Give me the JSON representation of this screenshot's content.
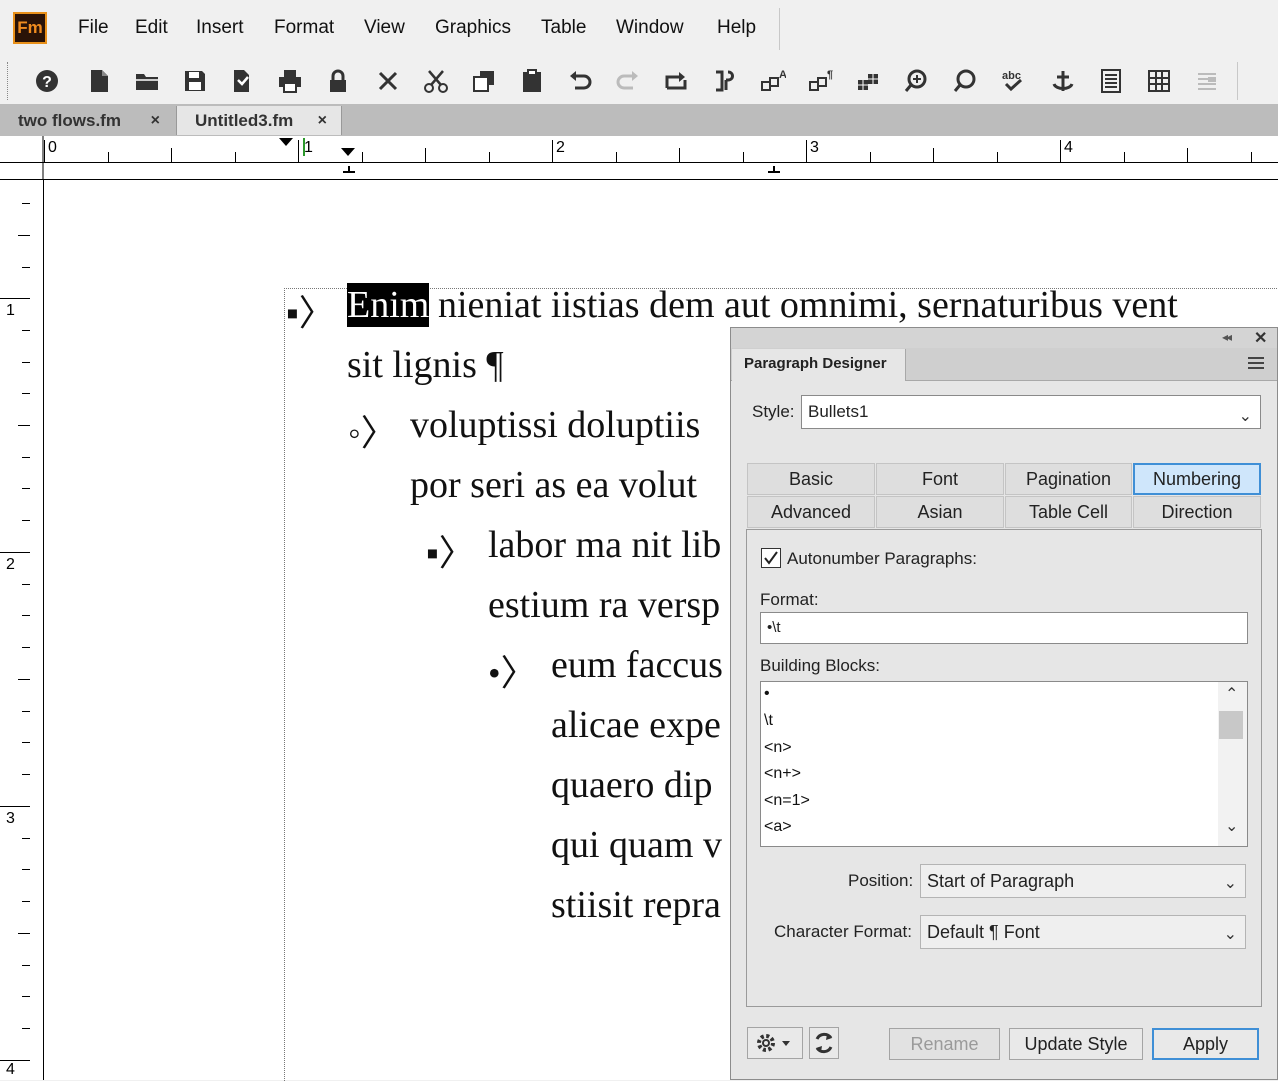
{
  "app": {
    "logo": "Fm"
  },
  "menu": [
    "File",
    "Edit",
    "Insert",
    "Format",
    "View",
    "Graphics",
    "Table",
    "Window",
    "Help"
  ],
  "toolbar": {
    "icons": [
      "help-icon",
      "new-document-icon",
      "open-folder-icon",
      "save-icon",
      "save-all-icon",
      "print-icon",
      "lock-icon",
      "close-icon",
      "cut-icon",
      "copy-icon",
      "paste-icon",
      "undo-icon",
      "redo-icon",
      "repeat-icon",
      "paragraph-flow-icon",
      "text-style-a-icon",
      "text-style-paragraph-icon",
      "table-insert-icon",
      "find-replace-icon",
      "search-icon",
      "spell-check-icon",
      "anchor-icon",
      "text-frame-icon",
      "table-icon",
      "list-style-icon"
    ]
  },
  "tabs": [
    {
      "label": "two flows.fm",
      "close": "×"
    },
    {
      "label": "Untitled3.fm",
      "close": "×"
    }
  ],
  "ruler": {
    "horizontal": [
      "0",
      "1",
      "2",
      "3",
      "4"
    ],
    "vertical": [
      "1",
      "2",
      "3",
      "4"
    ]
  },
  "document": {
    "line1_highlight": "Enim",
    "line1_rest": " nieniat iistias dem aut omnimi, sernaturibus vent",
    "line2": "sit lignis ¶",
    "line3": "voluptissi doluptiis",
    "line4": "por seri as ea volut",
    "line5": "labor ma nit lib",
    "line6": "estium ra versp",
    "line7": "eum faccus",
    "line8": "alicae expe",
    "line9": "quaero dip",
    "line10": "qui quam v",
    "line11": "stiisit repra",
    "bullet1": "▪〉",
    "bullet2": "◦〉",
    "bullet3": "▪〉",
    "bullet4": "•〉"
  },
  "panel": {
    "title": "Paragraph Designer",
    "style_label": "Style:",
    "style_value": "Bullets1",
    "tabs_row1": [
      "Basic",
      "Font",
      "Pagination",
      "Numbering"
    ],
    "tabs_row2": [
      "Advanced",
      "Asian",
      "Table Cell",
      "Direction"
    ],
    "active_tab": "Numbering",
    "autonumber_label": "Autonumber Paragraphs:",
    "autonumber_checked": true,
    "format_label": "Format:",
    "format_value": "•\\t",
    "building_blocks_label": "Building Blocks:",
    "building_blocks": [
      "•",
      "\\t",
      "<n>",
      "<n+>",
      "<n=1>",
      "<a>"
    ],
    "position_label": "Position:",
    "position_value": "Start of Paragraph",
    "char_format_label": "Character Format:",
    "char_format_value": "Default ¶ Font",
    "buttons": {
      "rename": "Rename",
      "update": "Update Style",
      "apply": "Apply"
    },
    "icons": [
      "gear-icon",
      "refresh-icon",
      "panel-menu-icon",
      "collapse-icon",
      "close-icon"
    ]
  },
  "colors": {
    "accent": "#3f8fd6",
    "logo_bg": "#2a1307",
    "logo_fg": "#f08c1f"
  }
}
